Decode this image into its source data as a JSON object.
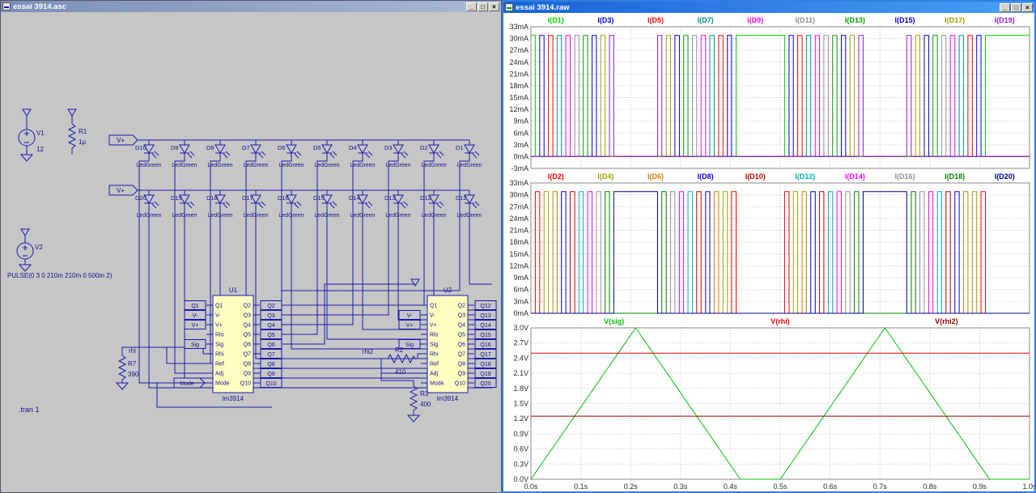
{
  "window_controls": {
    "minimize": "_",
    "maximize": "□",
    "close": "×"
  },
  "left_window": {
    "title": "essai 3914.asc",
    "schematic": {
      "v1": {
        "ref": "V1",
        "value": "12"
      },
      "r1": {
        "ref": "R1",
        "value": "1μ"
      },
      "v2": {
        "ref": "V2",
        "value": "PULSE(0 3 0 210m 210m 0 500m 2)"
      },
      "r7": {
        "ref": "R7",
        "value": "390"
      },
      "r2": {
        "ref": "R2",
        "value": "410"
      },
      "r3": {
        "ref": "R3",
        "value": "400"
      },
      "net_labels": {
        "vplus_top": "V+",
        "vplus_bottom": "V+",
        "rhi": "rhi",
        "rhi2": "rhi2",
        "mode": "Mode"
      },
      "directive": ".tran 1",
      "led_model": "LedGreen",
      "led_row_top": [
        "D10",
        "D9",
        "D8",
        "D7",
        "D6",
        "D5",
        "D4",
        "D3",
        "D2",
        "D1"
      ],
      "led_row_bottom": [
        "D20",
        "D19",
        "D18",
        "D17",
        "D16",
        "D15",
        "D14",
        "D13",
        "D12",
        "D11"
      ],
      "u1": {
        "ref": "U1",
        "part": "lm3914",
        "pins_left": [
          "Q1",
          "V-",
          "V+",
          "Rlo",
          "Sig",
          "Rhi",
          "Ref",
          "Adj",
          "Mode"
        ],
        "pins_right": [
          "Q2",
          "Q3",
          "Q4",
          "Q5",
          "Q6",
          "Q7",
          "Q8",
          "Q9",
          "Q10"
        ],
        "tags_left": [
          "Q1",
          "V-",
          "V+",
          "Sig"
        ],
        "tags_left_rows": [
          0,
          1,
          2,
          4
        ],
        "tags_right": [
          "Q2",
          "Q3",
          "Q4",
          "Q5",
          "Q6",
          "Q7",
          "Q8",
          "Q9",
          "Q10"
        ]
      },
      "u2": {
        "ref": "U2",
        "part": "lm3914",
        "pins_left": [
          "Q1",
          "V-",
          "V+",
          "Rlo",
          "Sig",
          "Rhi",
          "Ref",
          "Adj",
          "Mode"
        ],
        "pins_right": [
          "Q2",
          "Q3",
          "Q4",
          "Q5",
          "Q6",
          "Q7",
          "Q8",
          "Q9",
          "Q10"
        ],
        "tags_left": [
          "V-",
          "V+",
          "Sig"
        ],
        "tags_left_rows": [
          1,
          2,
          4
        ],
        "tags_right": [
          "Q12",
          "Q13",
          "Q14",
          "Q15",
          "Q16",
          "Q17",
          "Q18",
          "Q19",
          "Q20"
        ]
      }
    }
  },
  "right_window": {
    "title": "essai 3914.raw"
  },
  "chart_data": [
    {
      "type": "line",
      "pane": "top-led-currents",
      "y_unit": "mA",
      "y_decimals": 0,
      "ylim": [
        -3,
        33
      ],
      "ytick_step": 3,
      "xlim": [
        0,
        1
      ],
      "xtick_step": 0.1,
      "grid": true,
      "pulse_high_mA": 30.8,
      "threshold_step_V": 0.125,
      "signal_triangle": [
        [
          0,
          0
        ],
        [
          0.21,
          3
        ],
        [
          0.42,
          0
        ],
        [
          0.5,
          0
        ],
        [
          0.71,
          3
        ],
        [
          0.92,
          0
        ],
        [
          1,
          0
        ]
      ],
      "series": [
        {
          "name": "I(D1)",
          "color": "#00d400",
          "led": 1
        },
        {
          "name": "I(D3)",
          "color": "#0000ff",
          "led": 3
        },
        {
          "name": "I(D5)",
          "color": "#ff0000",
          "led": 5
        },
        {
          "name": "I(D7)",
          "color": "#009090",
          "led": 7
        },
        {
          "name": "I(D9)",
          "color": "#ff00ff",
          "led": 9
        },
        {
          "name": "I(D11)",
          "color": "#909090",
          "led": 11
        },
        {
          "name": "I(D13)",
          "color": "#00a000",
          "led": 13
        },
        {
          "name": "I(D15)",
          "color": "#0000e0",
          "led": 15
        },
        {
          "name": "I(D17)",
          "color": "#a0a000",
          "led": 17
        },
        {
          "name": "I(D19)",
          "color": "#9020d0",
          "led": 19
        }
      ]
    },
    {
      "type": "line",
      "pane": "middle-led-currents",
      "y_unit": "mA",
      "y_decimals": 0,
      "ylim": [
        0,
        33
      ],
      "ytick_step": 3,
      "xlim": [
        0,
        1
      ],
      "xtick_step": 0.1,
      "grid": true,
      "pulse_high_mA": 30.8,
      "threshold_step_V": 0.125,
      "signal_triangle": [
        [
          0,
          0
        ],
        [
          0.21,
          3
        ],
        [
          0.42,
          0
        ],
        [
          0.5,
          0
        ],
        [
          0.71,
          3
        ],
        [
          0.92,
          0
        ],
        [
          1,
          0
        ]
      ],
      "series": [
        {
          "name": "I(D2)",
          "color": "#ff0000",
          "led": 2
        },
        {
          "name": "I(D4)",
          "color": "#a0a000",
          "led": 4
        },
        {
          "name": "I(D6)",
          "color": "#d08000",
          "led": 6
        },
        {
          "name": "I(D8)",
          "color": "#0000ff",
          "led": 8
        },
        {
          "name": "I(D10)",
          "color": "#c00000",
          "led": 10
        },
        {
          "name": "I(D12)",
          "color": "#00b0b0",
          "led": 12
        },
        {
          "name": "I(D14)",
          "color": "#ff00ff",
          "led": 14
        },
        {
          "name": "I(D16)",
          "color": "#909090",
          "led": 16
        },
        {
          "name": "I(D18)",
          "color": "#008000",
          "led": 18
        },
        {
          "name": "I(D20)",
          "color": "#000090",
          "led": 20
        }
      ]
    },
    {
      "type": "line",
      "pane": "voltages",
      "y_unit": "V",
      "y_decimals": 1,
      "ylim": [
        0,
        3
      ],
      "ytick_step": 0.3,
      "xlim": [
        0,
        1
      ],
      "xtick_step": 0.1,
      "x_unit": "s",
      "x_decimals": 1,
      "grid": true,
      "series": [
        {
          "name": "V(sig)",
          "color": "#00c000",
          "points": [
            [
              0,
              0
            ],
            [
              0.21,
              3
            ],
            [
              0.42,
              0
            ],
            [
              0.5,
              0
            ],
            [
              0.71,
              3
            ],
            [
              0.92,
              0
            ],
            [
              1,
              0
            ]
          ]
        },
        {
          "name": "V(rhi)",
          "color": "#ff0000",
          "points": [
            [
              0,
              2.5
            ],
            [
              1,
              2.5
            ]
          ]
        },
        {
          "name": "V(rhi2)",
          "color": "#900000",
          "points": [
            [
              0,
              1.25
            ],
            [
              1,
              1.25
            ]
          ]
        }
      ]
    }
  ]
}
